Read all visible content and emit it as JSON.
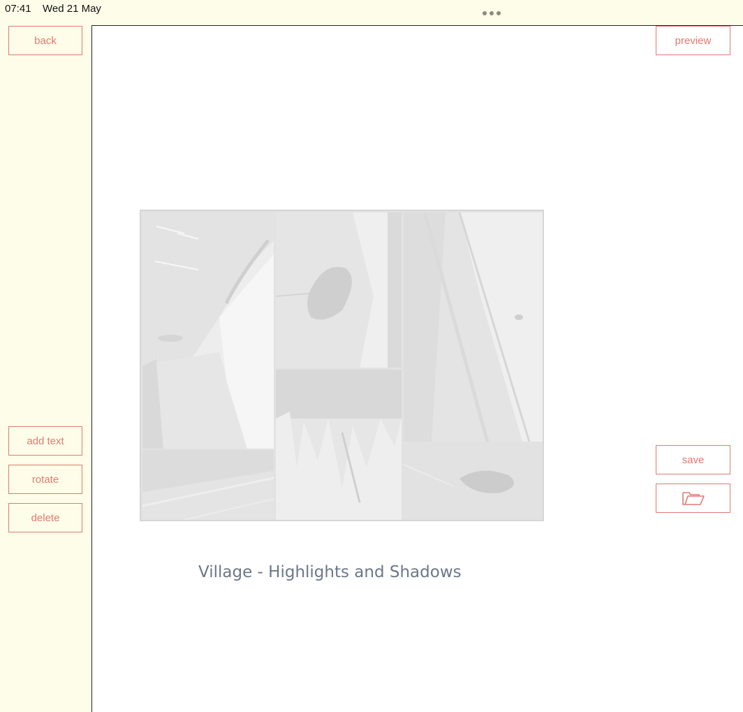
{
  "status_bar": {
    "time": "07:41",
    "date": "Wed 21 May"
  },
  "toolbar_left": {
    "back_label": "back",
    "add_text_label": "add text",
    "rotate_label": "rotate",
    "delete_label": "delete"
  },
  "toolbar_right": {
    "preview_label": "preview",
    "save_label": "save",
    "open_icon": "folder-open-icon"
  },
  "canvas": {
    "caption": "Village - Highlights and Shadows",
    "collage_tiles": [
      {
        "subject": "street-shadow-photo"
      },
      {
        "subject": "pavement-photo"
      },
      {
        "subject": "cracked-wall-photo"
      },
      {
        "subject": "splash-photo"
      },
      {
        "subject": "road-shadows-photo"
      },
      {
        "subject": "pothole-photo"
      }
    ]
  },
  "colors": {
    "background": "#fefde9",
    "accent": "#e07a72",
    "caption": "#6c7888",
    "canvas": "#ffffff"
  }
}
